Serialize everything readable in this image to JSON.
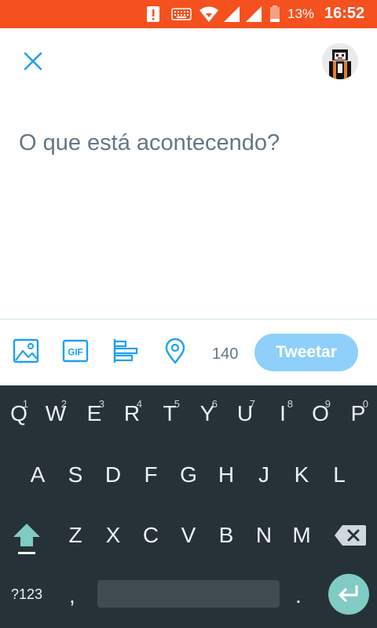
{
  "status_bar": {
    "battery_percent": "13%",
    "time": "16:52",
    "background_color": "#F4511E",
    "icons": [
      "alert-icon",
      "keyboard-icon",
      "wifi-icon",
      "signal-icon",
      "signal-icon",
      "battery-icon"
    ]
  },
  "compose": {
    "placeholder": "O que está acontecendo?",
    "value": ""
  },
  "toolbar": {
    "char_count": "140",
    "tweet_label": "Tweetar",
    "tweet_color": "#8ED0F9",
    "icon_color": "#1DA1F2",
    "gif_label": "GIF"
  },
  "keyboard": {
    "row1": [
      {
        "label": "Q",
        "hint": "1"
      },
      {
        "label": "W",
        "hint": "2"
      },
      {
        "label": "E",
        "hint": "3"
      },
      {
        "label": "R",
        "hint": "4"
      },
      {
        "label": "T",
        "hint": "5"
      },
      {
        "label": "Y",
        "hint": "6"
      },
      {
        "label": "U",
        "hint": "7"
      },
      {
        "label": "I",
        "hint": "8"
      },
      {
        "label": "O",
        "hint": "9"
      },
      {
        "label": "P",
        "hint": "0"
      }
    ],
    "row2": [
      "A",
      "S",
      "D",
      "F",
      "G",
      "H",
      "J",
      "K",
      "L"
    ],
    "row3": [
      "Z",
      "X",
      "C",
      "V",
      "B",
      "N",
      "M"
    ],
    "symbols_label": "?123",
    "comma_label": ",",
    "period_label": ".",
    "background_color": "#263238",
    "accent_color": "#80CBC4"
  }
}
